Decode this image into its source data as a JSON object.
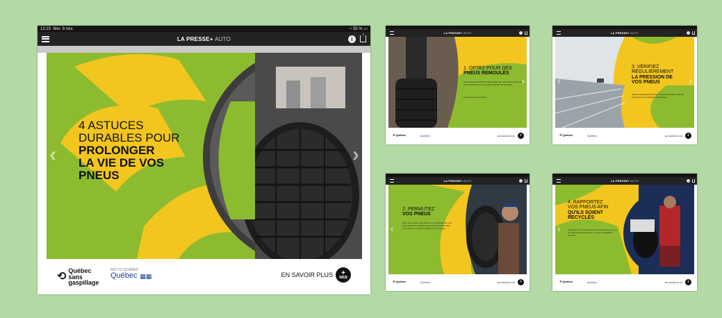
{
  "colors": {
    "green": "#8dbb2f",
    "yellow": "#f2c61f",
    "background": "#b3d9a4",
    "appbar": "#232323"
  },
  "status": {
    "time": "12:23",
    "date": "Mer. 8 nov.",
    "battery": "55 %"
  },
  "app": {
    "brand_main": "LA PRESSE+",
    "brand_sub": "AUTO",
    "menu_icon": "hamburger-icon",
    "info_icon": "info-icon",
    "share_icon": "share-icon"
  },
  "main_slide": {
    "line1": "4 ASTUCES",
    "line2": "DURABLES POUR",
    "line3": "PROLONGER",
    "line4": "LA VIE DE VOS",
    "line5": "PNEUS",
    "logo_line1": "Québec",
    "logo_line2": "sans",
    "logo_line3": "gaspillage",
    "recyc_tiny": "RECYC-QUÉBEC",
    "recyc": "Québec",
    "cta": "EN SAVOIR PLUS",
    "cta_icon_plus": "+",
    "cta_icon_web": "WEB"
  },
  "slides": [
    {
      "title_light": "1. OPTEZ POUR DES",
      "title_strong": "PNEUS REMOULÉS",
      "body": "Sont aussi performants et plus fiables que les pneus neufs, ces pneus réutilisés sont un parfait exemple de réemploi!",
      "note": "En savoir plus sur l'étude",
      "cta": "EN SAVOIR PLUS"
    },
    {
      "title_light": "3. VÉRIFIEZ",
      "title_light2": "RÉGULIÈREMENT",
      "title_strong": "LA PRESSION DE",
      "title_strong2": "VOS PNEUS",
      "body": "Faites-le particulièrement lors de grands froids ou autres variations de température importantes.",
      "cta": "EN SAVOIR PLUS"
    },
    {
      "title_light": "2. PERMUTEZ",
      "title_strong": "VOS PNEUS",
      "body": "Pour vous confier cette tâche à un professionnel ou à votre beau-frère, assurez-vous qu'elle soit bien faite pour assurer une usure uniforme de vos pneus.",
      "cta": "EN SAVOIR PLUS"
    },
    {
      "title_light": "4. RAPPORTEZ",
      "title_light2": "VOS PNEUS AFIN",
      "title_strong": "QU'ILS SOIENT",
      "title_strong2": "RECYCLÉS",
      "body": "Dès leurs fin de vie, donnez leur une deuxième vie en les rapportant à l'écocentre ou chez un détaillant autorisé.",
      "cta": "EN SAVOIR PLUS"
    }
  ]
}
